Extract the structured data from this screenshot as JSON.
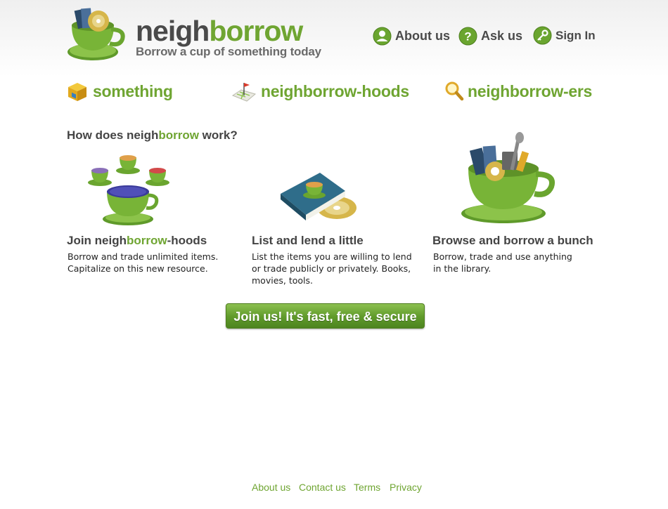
{
  "header": {
    "logo_part1": "neigh",
    "logo_part2": "borrow",
    "tagline": "Borrow a cup of something today"
  },
  "topnav": [
    {
      "label": "About us",
      "icon": "person-icon"
    },
    {
      "label": "Ask us",
      "icon": "question-icon"
    },
    {
      "label": "Sign In",
      "icon": "key-icon"
    }
  ],
  "categories": [
    {
      "label": "something",
      "icon": "box-icon"
    },
    {
      "label": "neighborrow-hoods",
      "icon": "map-flag-icon"
    },
    {
      "label": "neighborrow-ers",
      "icon": "magnifier-icon"
    }
  ],
  "how": {
    "prefix": "How does neigh",
    "highlight": "borrow",
    "suffix": " work?"
  },
  "steps": [
    {
      "title_pre": "Join neigh",
      "title_hl": "borrow",
      "title_post": "-hoods",
      "desc": "Borrow and trade unlimited items.\nCapitalize on this new resource."
    },
    {
      "title": "List and lend a little",
      "desc": "List the items you are willing to lend\nor trade publicly or privately. Books,\nmovies, tools."
    },
    {
      "title": "Browse and borrow a bunch",
      "desc": "Borrow, trade and use anything\nin the library."
    }
  ],
  "cta": {
    "label": "Join us! It's fast, free & secure"
  },
  "footer": [
    "About us",
    "Contact us",
    "Terms",
    "Privacy"
  ],
  "colors": {
    "brand_green": "#6fa532",
    "text_dark": "#444444"
  }
}
